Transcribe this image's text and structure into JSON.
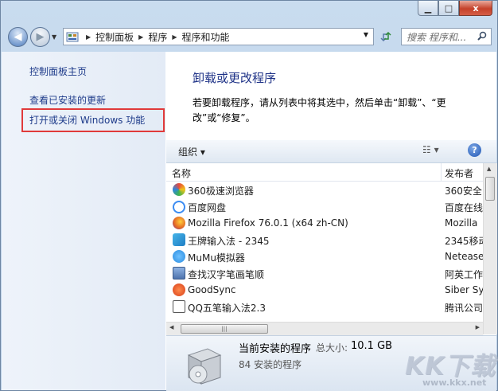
{
  "window": {
    "minimize_icon": "minimize-icon",
    "maximize_icon": "maximize-icon",
    "close_icon": "close-icon",
    "close_glyph": "x"
  },
  "navbar": {
    "breadcrumbs": [
      "控制面板",
      "程序",
      "程序和功能"
    ],
    "search_placeholder": "搜索 程序和...",
    "back_icon": "back-arrow-icon",
    "forward_icon": "forward-arrow-icon",
    "refresh_icon": "refresh-icon"
  },
  "sidebar": {
    "items": [
      "控制面板主页",
      "查看已安装的更新",
      "打开或关闭 Windows 功能"
    ]
  },
  "main": {
    "heading": "卸载或更改程序",
    "description": "若要卸载程序，请从列表中将其选中，然后单击“卸载”、“更改”或“修复”。"
  },
  "toolbar": {
    "organize_label": "组织 ▾",
    "view_icon": "view-options-icon",
    "help_icon": "help-icon"
  },
  "columns": {
    "name": "名称",
    "publisher": "发布者"
  },
  "programs": [
    {
      "name": "360极速浏览器",
      "publisher": "360安全",
      "icon": "360-browser-icon",
      "color": "#f0c419"
    },
    {
      "name": "百度网盘",
      "publisher": "百度在线",
      "icon": "baidu-netdisk-icon",
      "color": "#3b8cf2"
    },
    {
      "name": "Mozilla Firefox 76.0.1 (x64 zh-CN)",
      "publisher": "Mozilla",
      "icon": "firefox-icon",
      "color": "#e66c23"
    },
    {
      "name": "王牌输入法 - 2345",
      "publisher": "2345移动",
      "icon": "input-method-icon",
      "color": "#2f9bd6"
    },
    {
      "name": "MuMu模拟器",
      "publisher": "Netease",
      "icon": "mumu-icon",
      "color": "#2b8de0"
    },
    {
      "name": "查找汉字笔画笔顺",
      "publisher": "阿英工作",
      "icon": "app-window-icon",
      "color": "#6a8fc4"
    },
    {
      "name": "GoodSync",
      "publisher": "Siber Sy",
      "icon": "goodsync-icon",
      "color": "#e0531c"
    },
    {
      "name": "QQ五笔输入法2.3",
      "publisher": "腾讯公司",
      "icon": "qq-wubi-icon",
      "color": "#c0392b"
    }
  ],
  "status": {
    "title": "当前安装的程序",
    "size_label": "总大小:",
    "size_value": "10.1 GB",
    "count_text": "84 安装的程序",
    "icon": "installer-box-icon"
  },
  "watermark": {
    "text": "KK下载",
    "url": "www.kkx.net"
  }
}
